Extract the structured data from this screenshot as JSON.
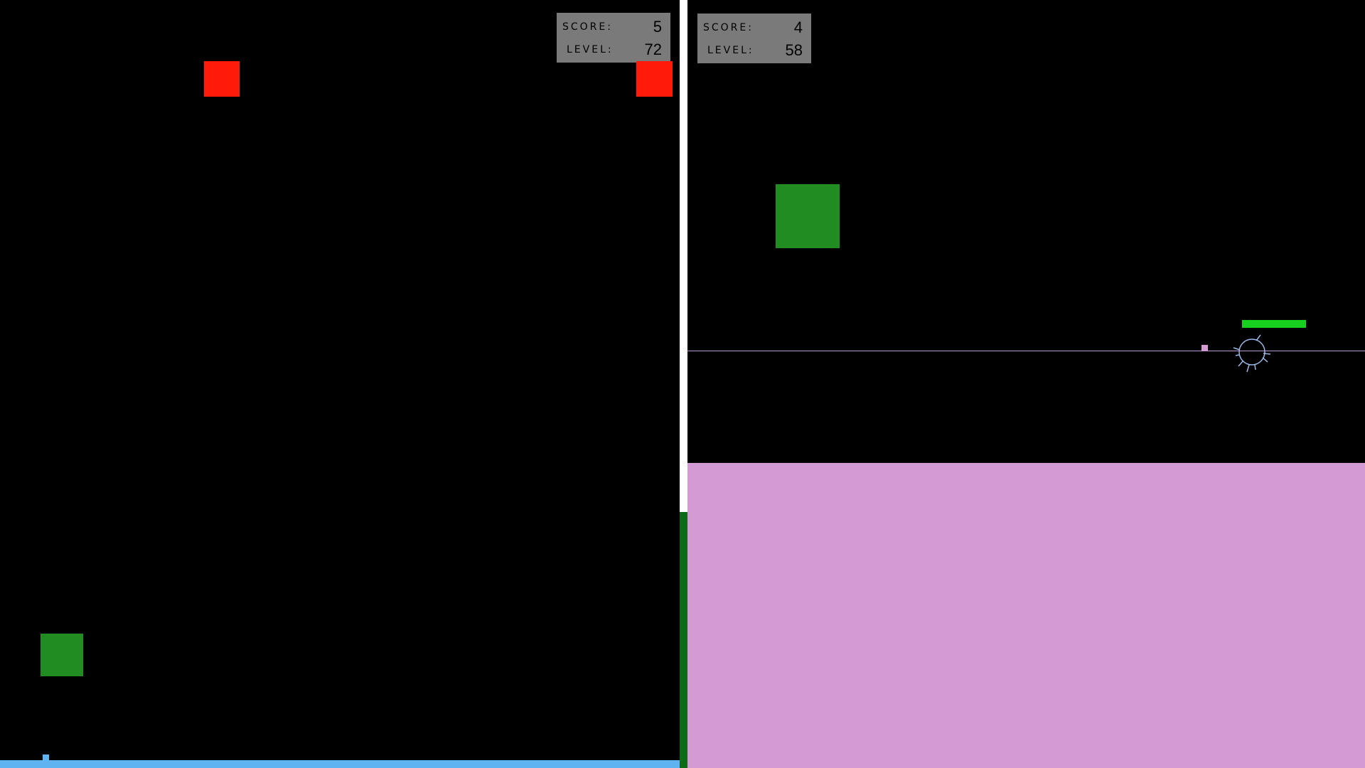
{
  "left_pane": {
    "hud": {
      "score_label": "SCORE:",
      "score_value": "5",
      "level_label": "LEVEL:",
      "level_value": "72"
    }
  },
  "right_pane": {
    "hud": {
      "score_label": "SCORE:",
      "score_value": "4",
      "level_label": "LEVEL:",
      "level_value": "58"
    }
  },
  "colors": {
    "background": "#000000",
    "hud_panel": "#7a7a7a",
    "enemy_block": "#ff1a0a",
    "target_block": "#218c22",
    "ground": "#5fb3f0",
    "floor": "#d49ad3",
    "health_bar": "#16d21e",
    "divider": "#ffffff",
    "divider_bottom": "#0d6a17"
  },
  "icons": {
    "crosshair": "crosshair-icon"
  }
}
